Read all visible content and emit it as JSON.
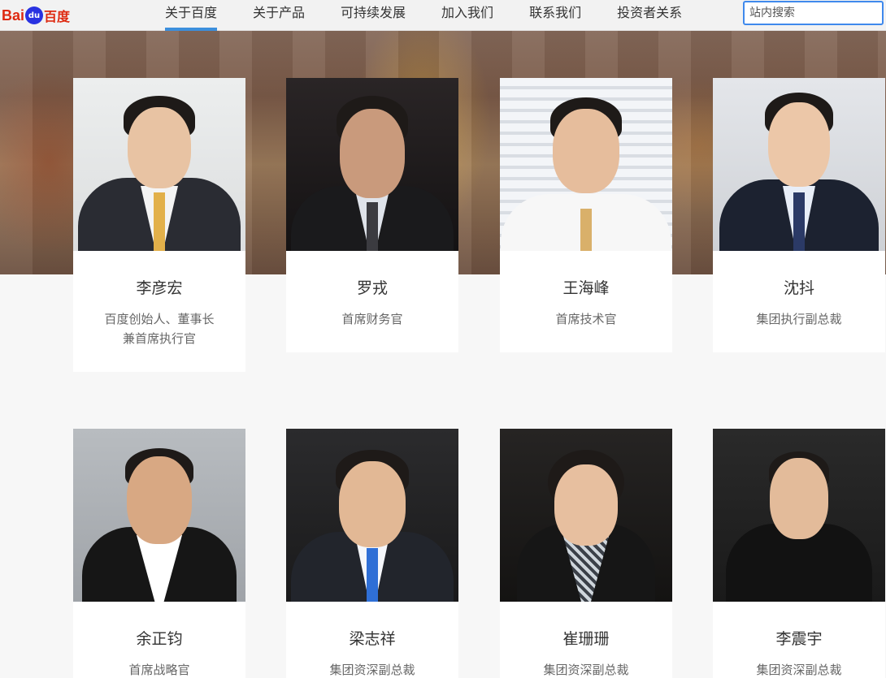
{
  "header": {
    "logo_text": "Bai",
    "logo_paw": "du",
    "logo_cn": "百度",
    "nav": [
      {
        "label": "关于百度",
        "active": true
      },
      {
        "label": "关于产品",
        "active": false
      },
      {
        "label": "可持续发展",
        "active": false
      },
      {
        "label": "加入我们",
        "active": false
      },
      {
        "label": "联系我们",
        "active": false
      },
      {
        "label": "投资者关系",
        "active": false
      }
    ],
    "search_placeholder": "站内搜索"
  },
  "colors": {
    "brand_red": "#de2910",
    "brand_blue": "#2932e1",
    "nav_active": "#3c8fdc"
  },
  "executives": [
    {
      "name": "李彦宏",
      "title_lines": [
        "百度创始人、董事长",
        "兼首席执行官"
      ]
    },
    {
      "name": "罗戎",
      "title_lines": [
        "首席财务官"
      ]
    },
    {
      "name": "王海峰",
      "title_lines": [
        "首席技术官"
      ]
    },
    {
      "name": "沈抖",
      "title_lines": [
        "集团执行副总裁"
      ]
    },
    {
      "name": "余正钧",
      "title_lines": [
        "首席战略官"
      ]
    },
    {
      "name": "梁志祥",
      "title_lines": [
        "集团资深副总裁"
      ]
    },
    {
      "name": "崔珊珊",
      "title_lines": [
        "集团资深副总裁"
      ]
    },
    {
      "name": "李震宇",
      "title_lines": [
        "集团资深副总裁"
      ]
    }
  ]
}
